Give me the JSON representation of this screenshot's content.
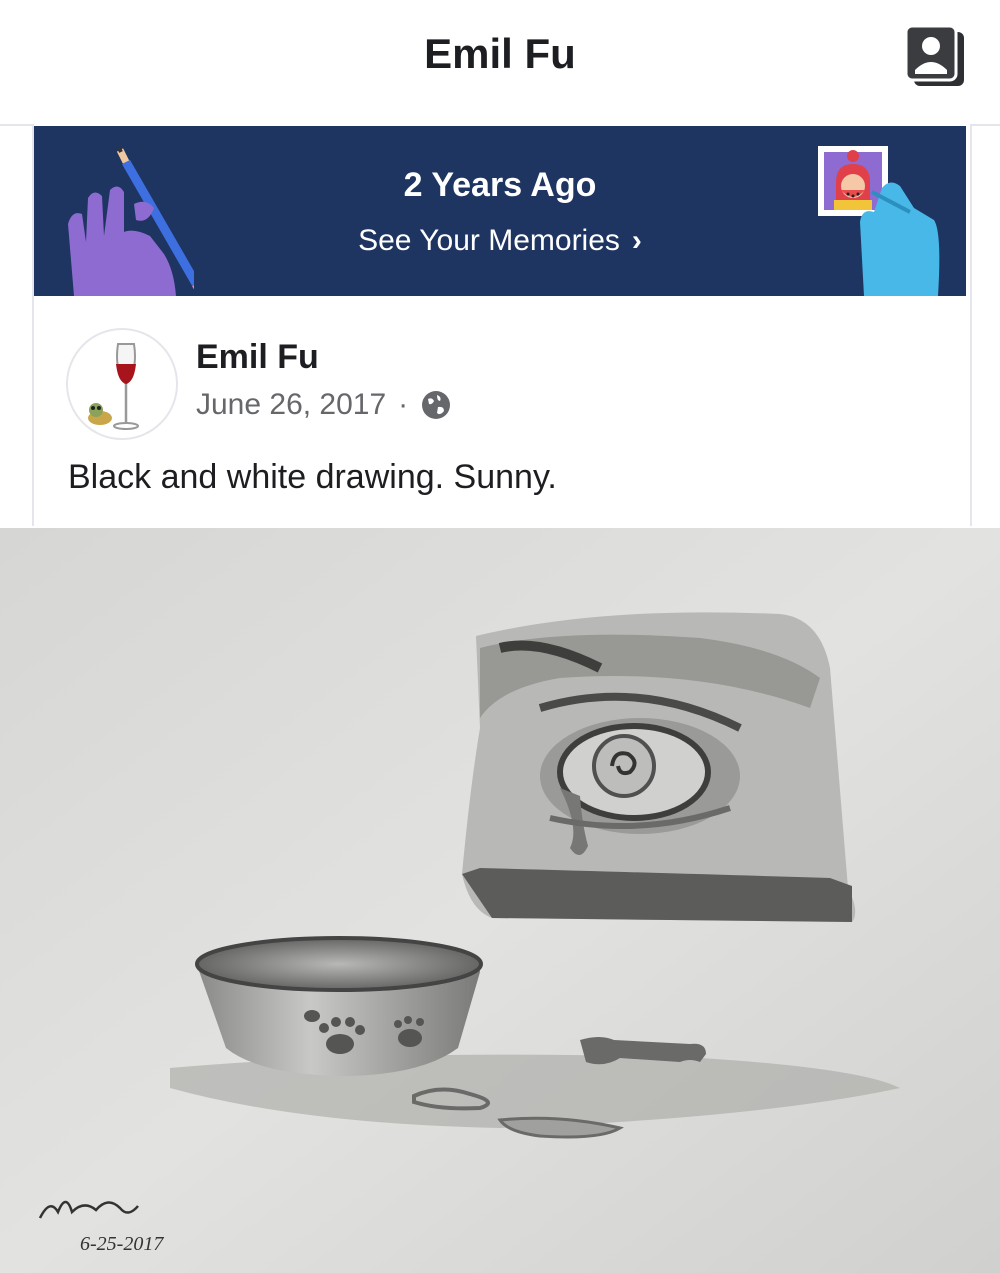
{
  "header": {
    "title": "Emil Fu"
  },
  "memories": {
    "title": "2 Years Ago",
    "link_label": "See Your Memories",
    "chevron": "›",
    "banner_color": "#1e3461"
  },
  "post": {
    "author": "Emil Fu",
    "date": "June 26, 2017",
    "separator": "·",
    "privacy_icon": "globe-icon",
    "text": "Black and white drawing. Sunny."
  },
  "photo": {
    "signature_name": "Emilfu",
    "signature_date": "6-25-2017"
  },
  "colors": {
    "text_primary": "#1c1e21",
    "text_secondary": "#65676b",
    "divider": "#e4e6eb"
  }
}
